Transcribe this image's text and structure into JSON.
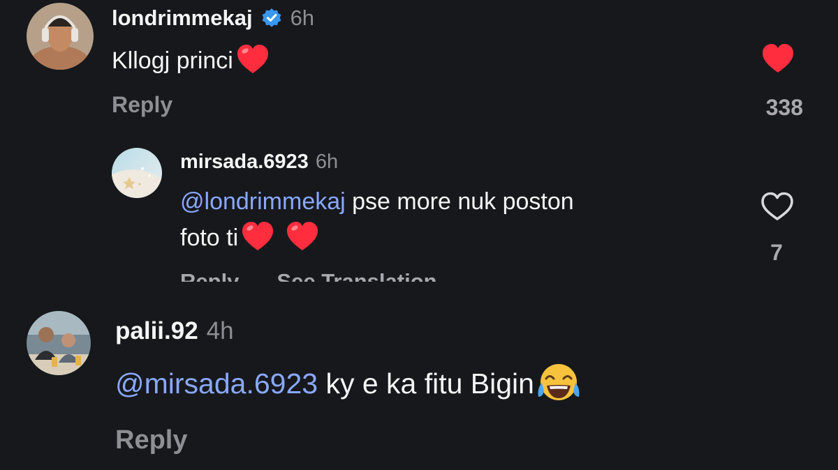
{
  "comments": [
    {
      "username": "londrimmekaj",
      "verified": true,
      "time": "6h",
      "text": "Kllogj princi",
      "liked": true,
      "like_count": "338",
      "reply_label": "Reply"
    },
    {
      "username": "mirsada.6923",
      "time": "6h",
      "mention": "@londrimmekaj",
      "text_line1": " pse more nuk poston",
      "text_line2": "foto ti",
      "liked": false,
      "like_count": "7",
      "reply_label": "Reply",
      "translate_label": "See Translation"
    },
    {
      "username": "palii.92",
      "time": "4h",
      "mention": "@mirsada.6923",
      "text": " ky e ka fitu Bigin ",
      "reply_label": "Reply"
    }
  ],
  "colors": {
    "background": "#16181c",
    "mention": "#8aa8ff",
    "heart_red": "#ff2d3d",
    "verified_blue": "#3897f0",
    "muted": "#8e8e93"
  },
  "icons": [
    "heart-filled-icon",
    "heart-outline-icon",
    "verified-badge-icon",
    "red-heart-emoji",
    "tears-of-joy-emoji"
  ]
}
